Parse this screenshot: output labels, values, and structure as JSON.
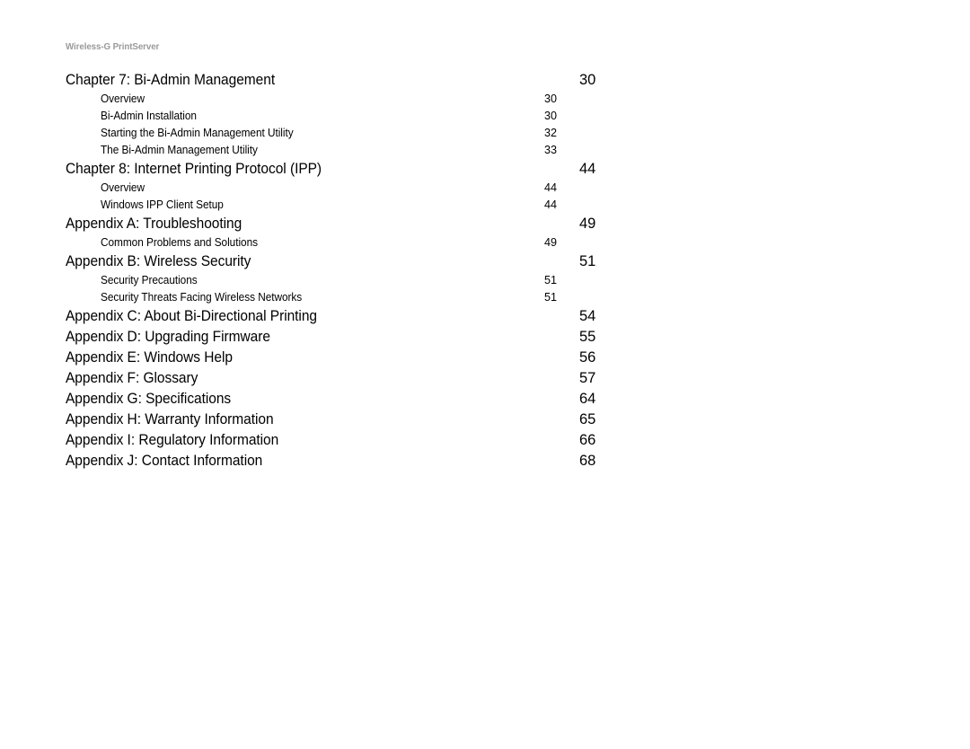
{
  "header": {
    "running_title": "Wireless-G PrintServer"
  },
  "colors": {
    "page_background": "#ffffff",
    "body_text": "#000000",
    "running_header_text": "#9a9a9a"
  },
  "toc": {
    "entries": [
      {
        "level": 1,
        "title": "Chapter 7: Bi-Admin Management",
        "page": "30"
      },
      {
        "level": 2,
        "title": "Overview",
        "page": "30"
      },
      {
        "level": 2,
        "title": "Bi-Admin Installation",
        "page": "30"
      },
      {
        "level": 2,
        "title": "Starting the Bi-Admin Management Utility",
        "page": "32"
      },
      {
        "level": 2,
        "title": "The Bi-Admin Management Utility",
        "page": "33"
      },
      {
        "level": 1,
        "title": "Chapter 8: Internet Printing Protocol (IPP)",
        "page": "44"
      },
      {
        "level": 2,
        "title": "Overview",
        "page": "44"
      },
      {
        "level": 2,
        "title": "Windows IPP Client Setup",
        "page": "44"
      },
      {
        "level": 1,
        "title": "Appendix A: Troubleshooting",
        "page": "49"
      },
      {
        "level": 2,
        "title": "Common Problems and Solutions",
        "page": "49"
      },
      {
        "level": 1,
        "title": "Appendix B: Wireless Security",
        "page": "51"
      },
      {
        "level": 2,
        "title": "Security Precautions",
        "page": "51"
      },
      {
        "level": 2,
        "title": "Security Threats Facing Wireless Networks",
        "page": "51"
      },
      {
        "level": 1,
        "title": "Appendix C: About Bi-Directional Printing",
        "page": "54"
      },
      {
        "level": 1,
        "title": "Appendix D: Upgrading Firmware",
        "page": "55"
      },
      {
        "level": 1,
        "title": "Appendix E: Windows Help",
        "page": "56"
      },
      {
        "level": 1,
        "title": "Appendix F: Glossary",
        "page": "57"
      },
      {
        "level": 1,
        "title": "Appendix G: Specifications",
        "page": "64"
      },
      {
        "level": 1,
        "title": "Appendix H: Warranty Information",
        "page": "65"
      },
      {
        "level": 1,
        "title": "Appendix I: Regulatory Information",
        "page": "66"
      },
      {
        "level": 1,
        "title": "Appendix J: Contact Information",
        "page": "68"
      }
    ]
  }
}
